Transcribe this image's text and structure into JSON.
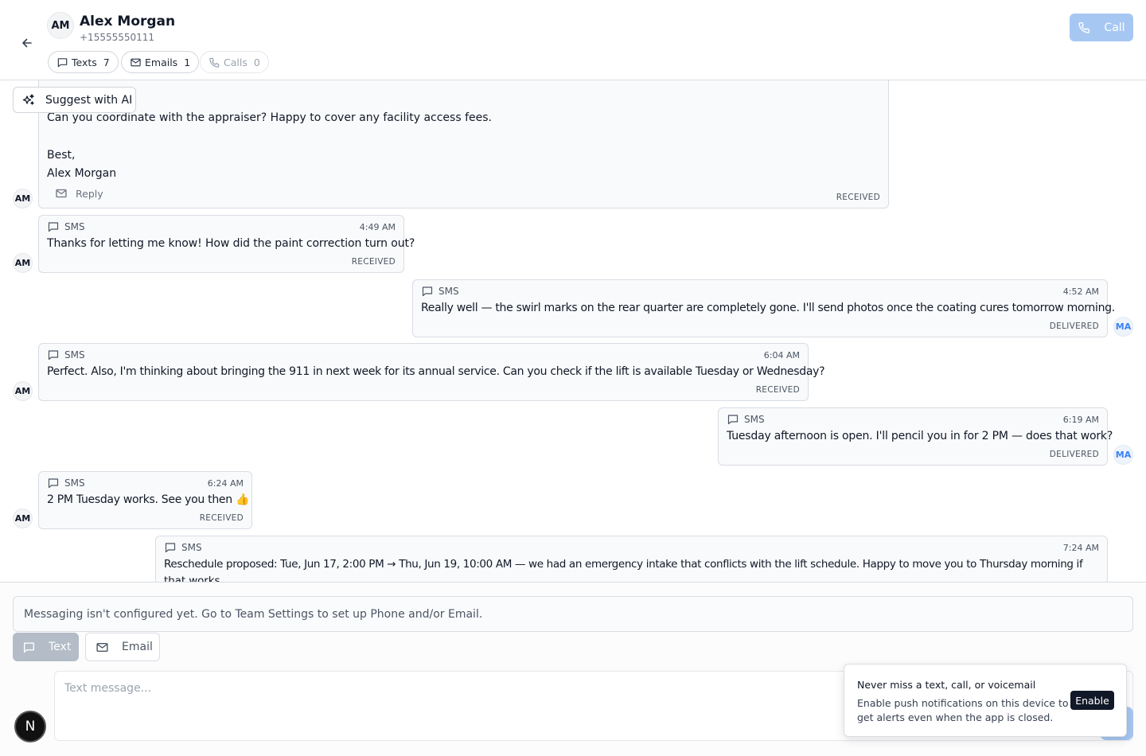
{
  "contact": {
    "initials": "AM",
    "name": "Alex Morgan",
    "phone": "+15555550111"
  },
  "filters": {
    "texts": {
      "label": "Texts",
      "count": "7"
    },
    "emails": {
      "label": "Emails",
      "count": "1"
    },
    "calls": {
      "label": "Calls",
      "count": "0"
    }
  },
  "call_button": {
    "label": "Call"
  },
  "suggest_button": {
    "label": "Suggest with AI"
  },
  "email_message": {
    "lines": [
      "Can you coordinate with the appraiser? Happy to cover any facility access fees.",
      "Best,",
      "Alex Morgan"
    ],
    "reply_label": "Reply",
    "status": "RECEIVED",
    "avatar": "AM"
  },
  "messages": [
    {
      "channel": "SMS",
      "time": "4:49 AM",
      "text": "Thanks for letting me know! How did the paint correction turn out?",
      "status": "RECEIVED",
      "avatar": "AM"
    },
    {
      "channel": "SMS",
      "time": "4:52 AM",
      "text": "Really well — the swirl marks on the rear quarter are completely gone. I'll send photos once the coating cures tomorrow morning.",
      "status": "DELIVERED",
      "avatar": "MA"
    },
    {
      "channel": "SMS",
      "time": "6:04 AM",
      "text": "Perfect. Also, I'm thinking about bringing the 911 in next week for its annual service. Can you check if the lift is available Tuesday or Wednesday?",
      "status": "RECEIVED",
      "avatar": "AM"
    },
    {
      "channel": "SMS",
      "time": "6:19 AM",
      "text": "Tuesday afternoon is open. I'll pencil you in for 2 PM — does that work?",
      "status": "DELIVERED",
      "avatar": "MA"
    },
    {
      "channel": "SMS",
      "time": "6:24 AM",
      "text": "2 PM Tuesday works. See you then 👍",
      "status": "RECEIVED",
      "avatar": "AM"
    },
    {
      "channel": "SMS",
      "time": "7:24 AM",
      "text": "Reschedule proposed: Tue, Jun 17, 2:00 PM → Thu, Jun 19, 10:00 AM — we had an emergency intake that conflicts with the lift schedule. Happy to move you to Thursday morning if",
      "text_cont": "that works.",
      "status": "",
      "avatar": ""
    }
  ],
  "composer": {
    "notice": "Messaging isn't configured yet. Go to Team Settings to set up Phone and/or Email.",
    "mode_text": "Text",
    "mode_email": "Email",
    "placeholder": "Text message..."
  },
  "dev_badge": "N",
  "toast": {
    "title": "Never miss a text, call, or voicemail",
    "body": "Enable push notifications on this device to get alerts even when the app is closed.",
    "button": "Enable"
  },
  "colors": {
    "accent": "#a7c7f3",
    "my_avatar_text": "#3b82f6",
    "border": "#d9dde3"
  }
}
